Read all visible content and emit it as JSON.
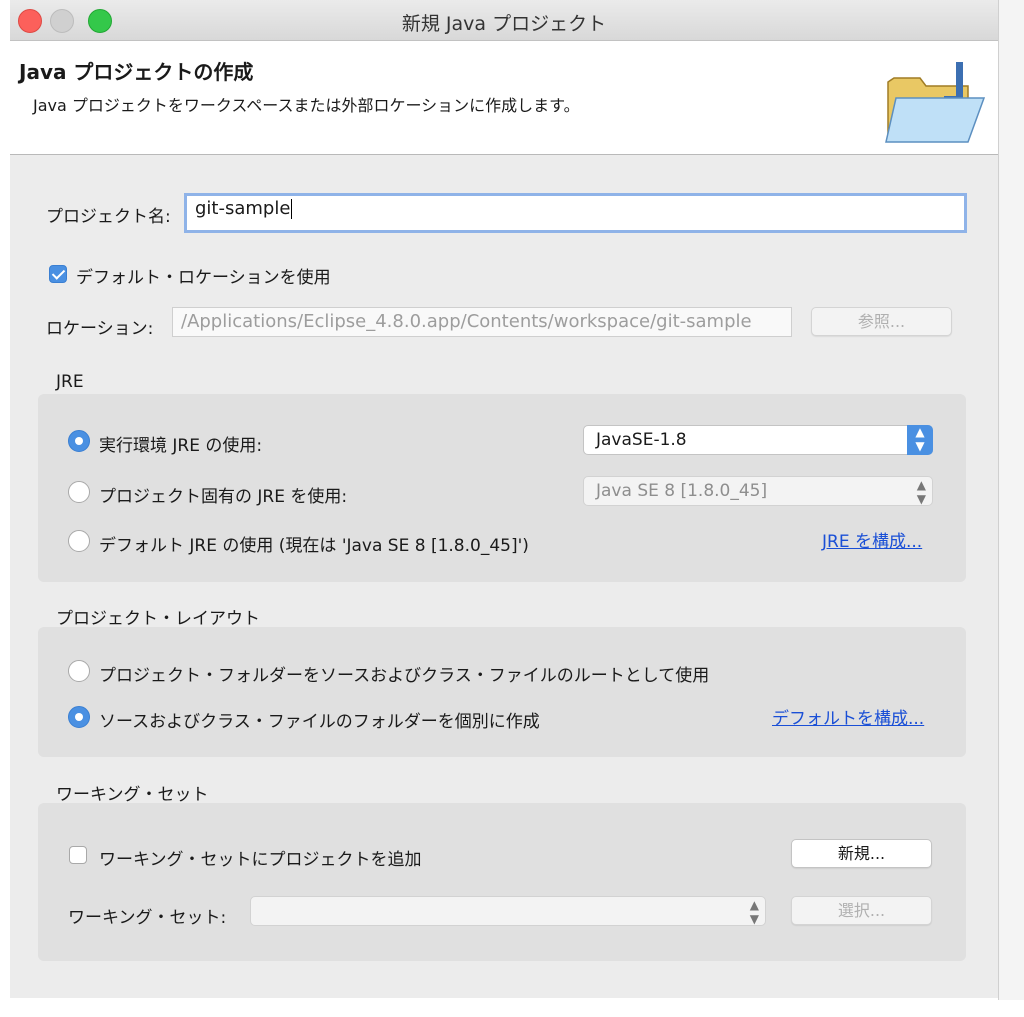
{
  "window": {
    "title": "新規 Java プロジェクト"
  },
  "header": {
    "title": "Java プロジェクトの作成",
    "description": "Java プロジェクトをワークスペースまたは外部ロケーションに作成します。"
  },
  "project_name": {
    "label": "プロジェクト名:",
    "value": "git-sample"
  },
  "default_location": {
    "label": "デフォルト・ロケーションを使用",
    "checked": true
  },
  "location": {
    "label": "ロケーション:",
    "value": "/Applications/Eclipse_4.8.0.app/Contents/workspace/git-sample",
    "browse_label": "参照..."
  },
  "jre": {
    "group_title": "JRE",
    "options": [
      {
        "label": "実行環境 JRE の使用:",
        "selected": true
      },
      {
        "label": "プロジェクト固有の JRE を使用:",
        "selected": false
      },
      {
        "label": "デフォルト JRE の使用 (現在は 'Java SE 8 [1.8.0_45]')",
        "selected": false
      }
    ],
    "env_select": "JavaSE-1.8",
    "project_jre_select": "Java SE 8 [1.8.0_45]",
    "configure_link": "JRE を構成..."
  },
  "layout": {
    "group_title": "プロジェクト・レイアウト",
    "options": [
      {
        "label": "プロジェクト・フォルダーをソースおよびクラス・ファイルのルートとして使用",
        "selected": false
      },
      {
        "label": "ソースおよびクラス・ファイルのフォルダーを個別に作成",
        "selected": true
      }
    ],
    "configure_link": "デフォルトを構成..."
  },
  "working_set": {
    "group_title": "ワーキング・セット",
    "add_label": "ワーキング・セットにプロジェクトを追加",
    "add_checked": false,
    "new_button": "新規...",
    "field_label": "ワーキング・セット:",
    "select_value": "",
    "select_button": "選択..."
  },
  "colors": {
    "accent": "#4a90e2",
    "link": "#1a4fd6"
  },
  "icons": [
    "java-project-folder-icon",
    "chevron-updown-icon"
  ]
}
